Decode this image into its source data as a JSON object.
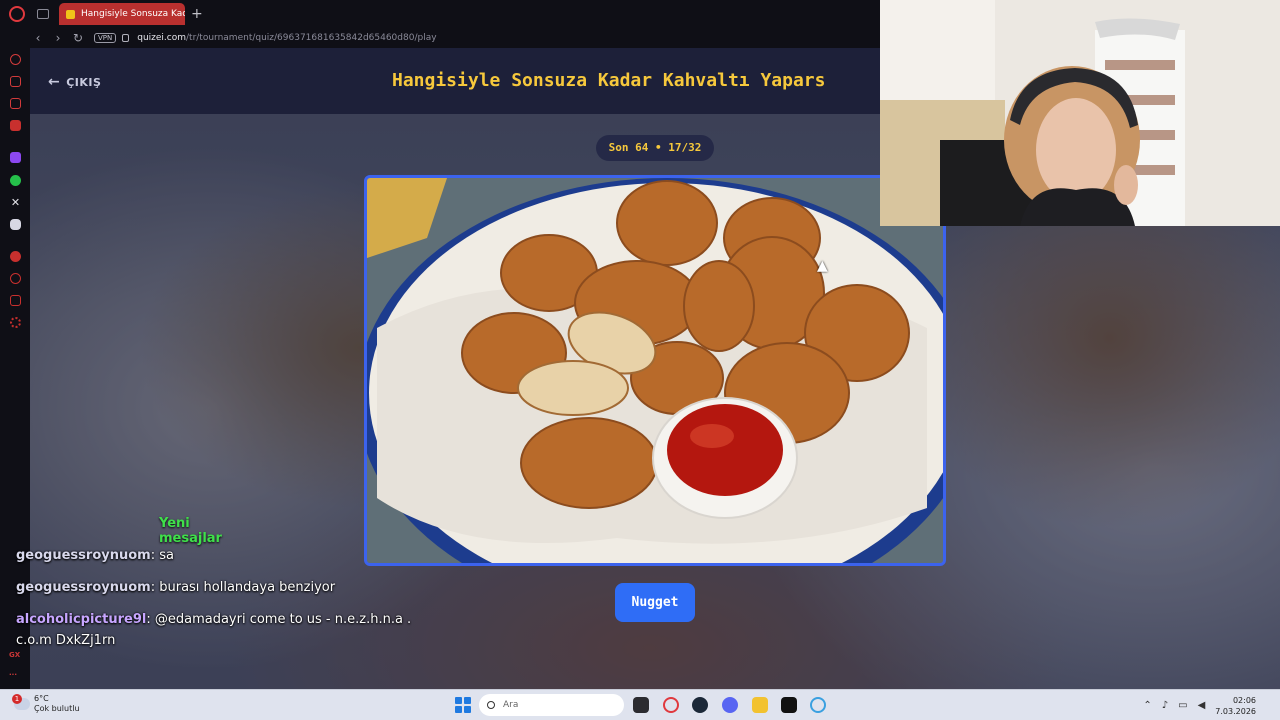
{
  "browser": {
    "tab_title": "Hangisiyle Sonsuza Kadar",
    "new_tab_glyph": "+",
    "vpn_label": "VPN",
    "url_host": "quizei.com",
    "url_path": "/tr/tournament/quiz/696371681635842d65460d80/play",
    "sidebar_badge": "GX",
    "sidebar_more": "..."
  },
  "quiz": {
    "exit_label": "ÇIKIŞ",
    "title": "Hangisiyle Sonsuza Kadar Kahvaltı Yapars",
    "round": "Son 64 • 17/32",
    "choice_label": "Nugget"
  },
  "chat": {
    "new_messages": "Yeni mesajlar",
    "messages": [
      {
        "user": "geoguessroynuom",
        "text": ": sa"
      },
      {
        "user": "geoguessroynuom",
        "text": ": burası hollandaya benziyor"
      },
      {
        "user": "alcoholicpicture9l",
        "text": ": @edamadayri come to us - n.e.z.h.n.a .",
        "cont": "c.o.m DxkZj1rn"
      }
    ]
  },
  "taskbar": {
    "notif_count": "1",
    "temp": "6°C",
    "weather": "Çok bulutlu",
    "search_placeholder": "Ara",
    "time": "02:06",
    "date": "7.03.2026"
  },
  "colors": {
    "accent_title": "#f6c83c",
    "button_blue": "#2f6df6",
    "chat_new": "#3fe04a",
    "opera_red": "#e0393e"
  }
}
